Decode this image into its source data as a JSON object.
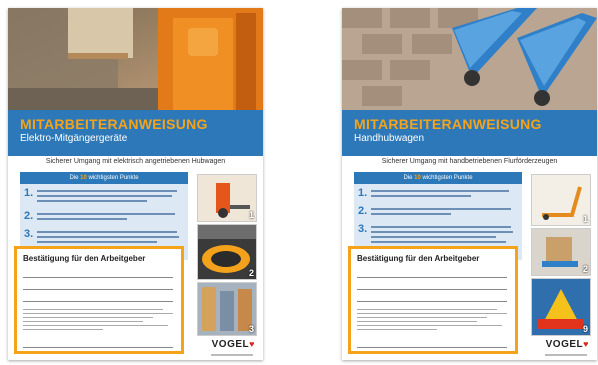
{
  "documents": [
    {
      "title": "MITARBEITERANWEISUNG",
      "subtitle": "Elektro-Mitgängergeräte",
      "tagline": "Sicherer Umgang mit elektrisch angetriebenen Hubwagen",
      "points_header_pre": "Die",
      "points_header_num": "10",
      "points_header_post": "wichtigsten Punkte",
      "point_numbers": [
        "1.",
        "2.",
        "3."
      ],
      "thumbnail_numbers": [
        "1",
        "2",
        "3"
      ],
      "confirm_title": "Bestätigung für den Arbeitgeber",
      "logo": "VOGEL",
      "colors": {
        "band": "#2d78b8",
        "accent": "#f5a31a",
        "points_bg": "#dce9f5"
      }
    },
    {
      "title": "MITARBEITERANWEISUNG",
      "subtitle": "Handhubwagen",
      "tagline": "Sicherer Umgang mit handbetriebenen Flurförderzeugen",
      "points_header_pre": "Die",
      "points_header_num": "10",
      "points_header_post": "wichtigsten Punkte",
      "point_numbers": [
        "1.",
        "2.",
        "3."
      ],
      "thumbnail_numbers": [
        "1",
        "2",
        "9"
      ],
      "confirm_title": "Bestätigung für den Arbeitgeber",
      "logo": "VOGEL",
      "colors": {
        "band": "#2d78b8",
        "accent": "#f5a31a",
        "points_bg": "#dce9f5"
      }
    }
  ]
}
